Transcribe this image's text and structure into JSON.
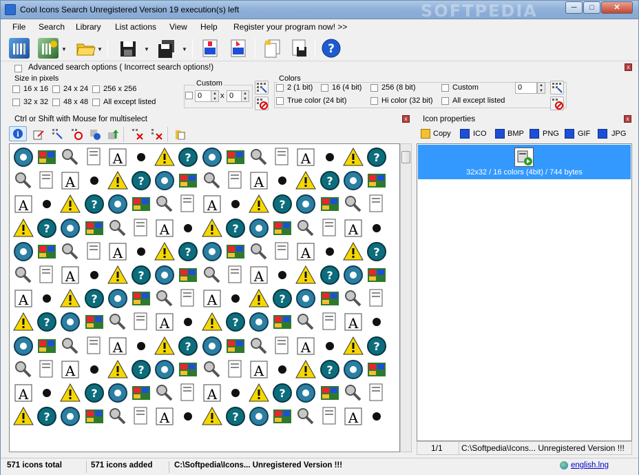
{
  "window": {
    "title": "Cool Icons Search  Unregistered Version 19 execution(s) left",
    "watermark": "SOFTPEDIA",
    "minimize_glyph": "─",
    "maximize_glyph": "□",
    "close_glyph": "✕"
  },
  "menu": {
    "file": "File",
    "search": "Search",
    "library": "Library",
    "list_actions": "List actions",
    "view": "View",
    "help": "Help",
    "register": "Register your program now! >>"
  },
  "toolbar": {
    "dropdown_glyph": "▼",
    "icons": [
      "library-icon",
      "library-add-icon",
      "open-folder-icon",
      "save-disk-icon",
      "save-all-icon",
      "ico-file-icon",
      "ico-extract-icon",
      "copy-docs-icon",
      "save-doc-icon",
      "help-icon"
    ]
  },
  "search_options": {
    "advanced_label": "Advanced search options ( Incorrect search options!)",
    "size_title": "Size in pixels",
    "sizes": [
      "16 x 16",
      "24 x 24",
      "256 x 256",
      "32 x 32",
      "48 x 48",
      "All except listed"
    ],
    "custom_title": "Custom",
    "custom_w": "0",
    "custom_x": "x",
    "custom_h": "0",
    "colors_title": "Colors",
    "colors": [
      "2 (1 bit)",
      "16 (4 bit)",
      "256 (8 bit)",
      "Custom",
      "True color (24 bit)",
      "Hi color (32 bit)",
      "All except listed"
    ],
    "colors_custom_value": "0",
    "close_glyph": "x"
  },
  "list_panel": {
    "header": "Ctrl or Shift with Mouse for multiselect",
    "close_glyph": "x",
    "icon_count": 192
  },
  "props_panel": {
    "header": "Icon properties",
    "close_glyph": "x",
    "actions": [
      "Copy",
      "ICO",
      "BMP",
      "PNG",
      "GIF",
      "JPG"
    ],
    "selected_info": "32x32 / 16 colors (4bit) / 744 bytes",
    "page": "1/1",
    "path": "C:\\Softpedia\\Icons... Unregistered Version !!!"
  },
  "status": {
    "total": "571 icons total",
    "added": "571 icons added",
    "path": "C:\\Softpedia\\Icons... Unregistered Version !!!",
    "language": "english.lng"
  },
  "colors": {
    "selection": "#3399ff",
    "link": "#0000cc"
  }
}
